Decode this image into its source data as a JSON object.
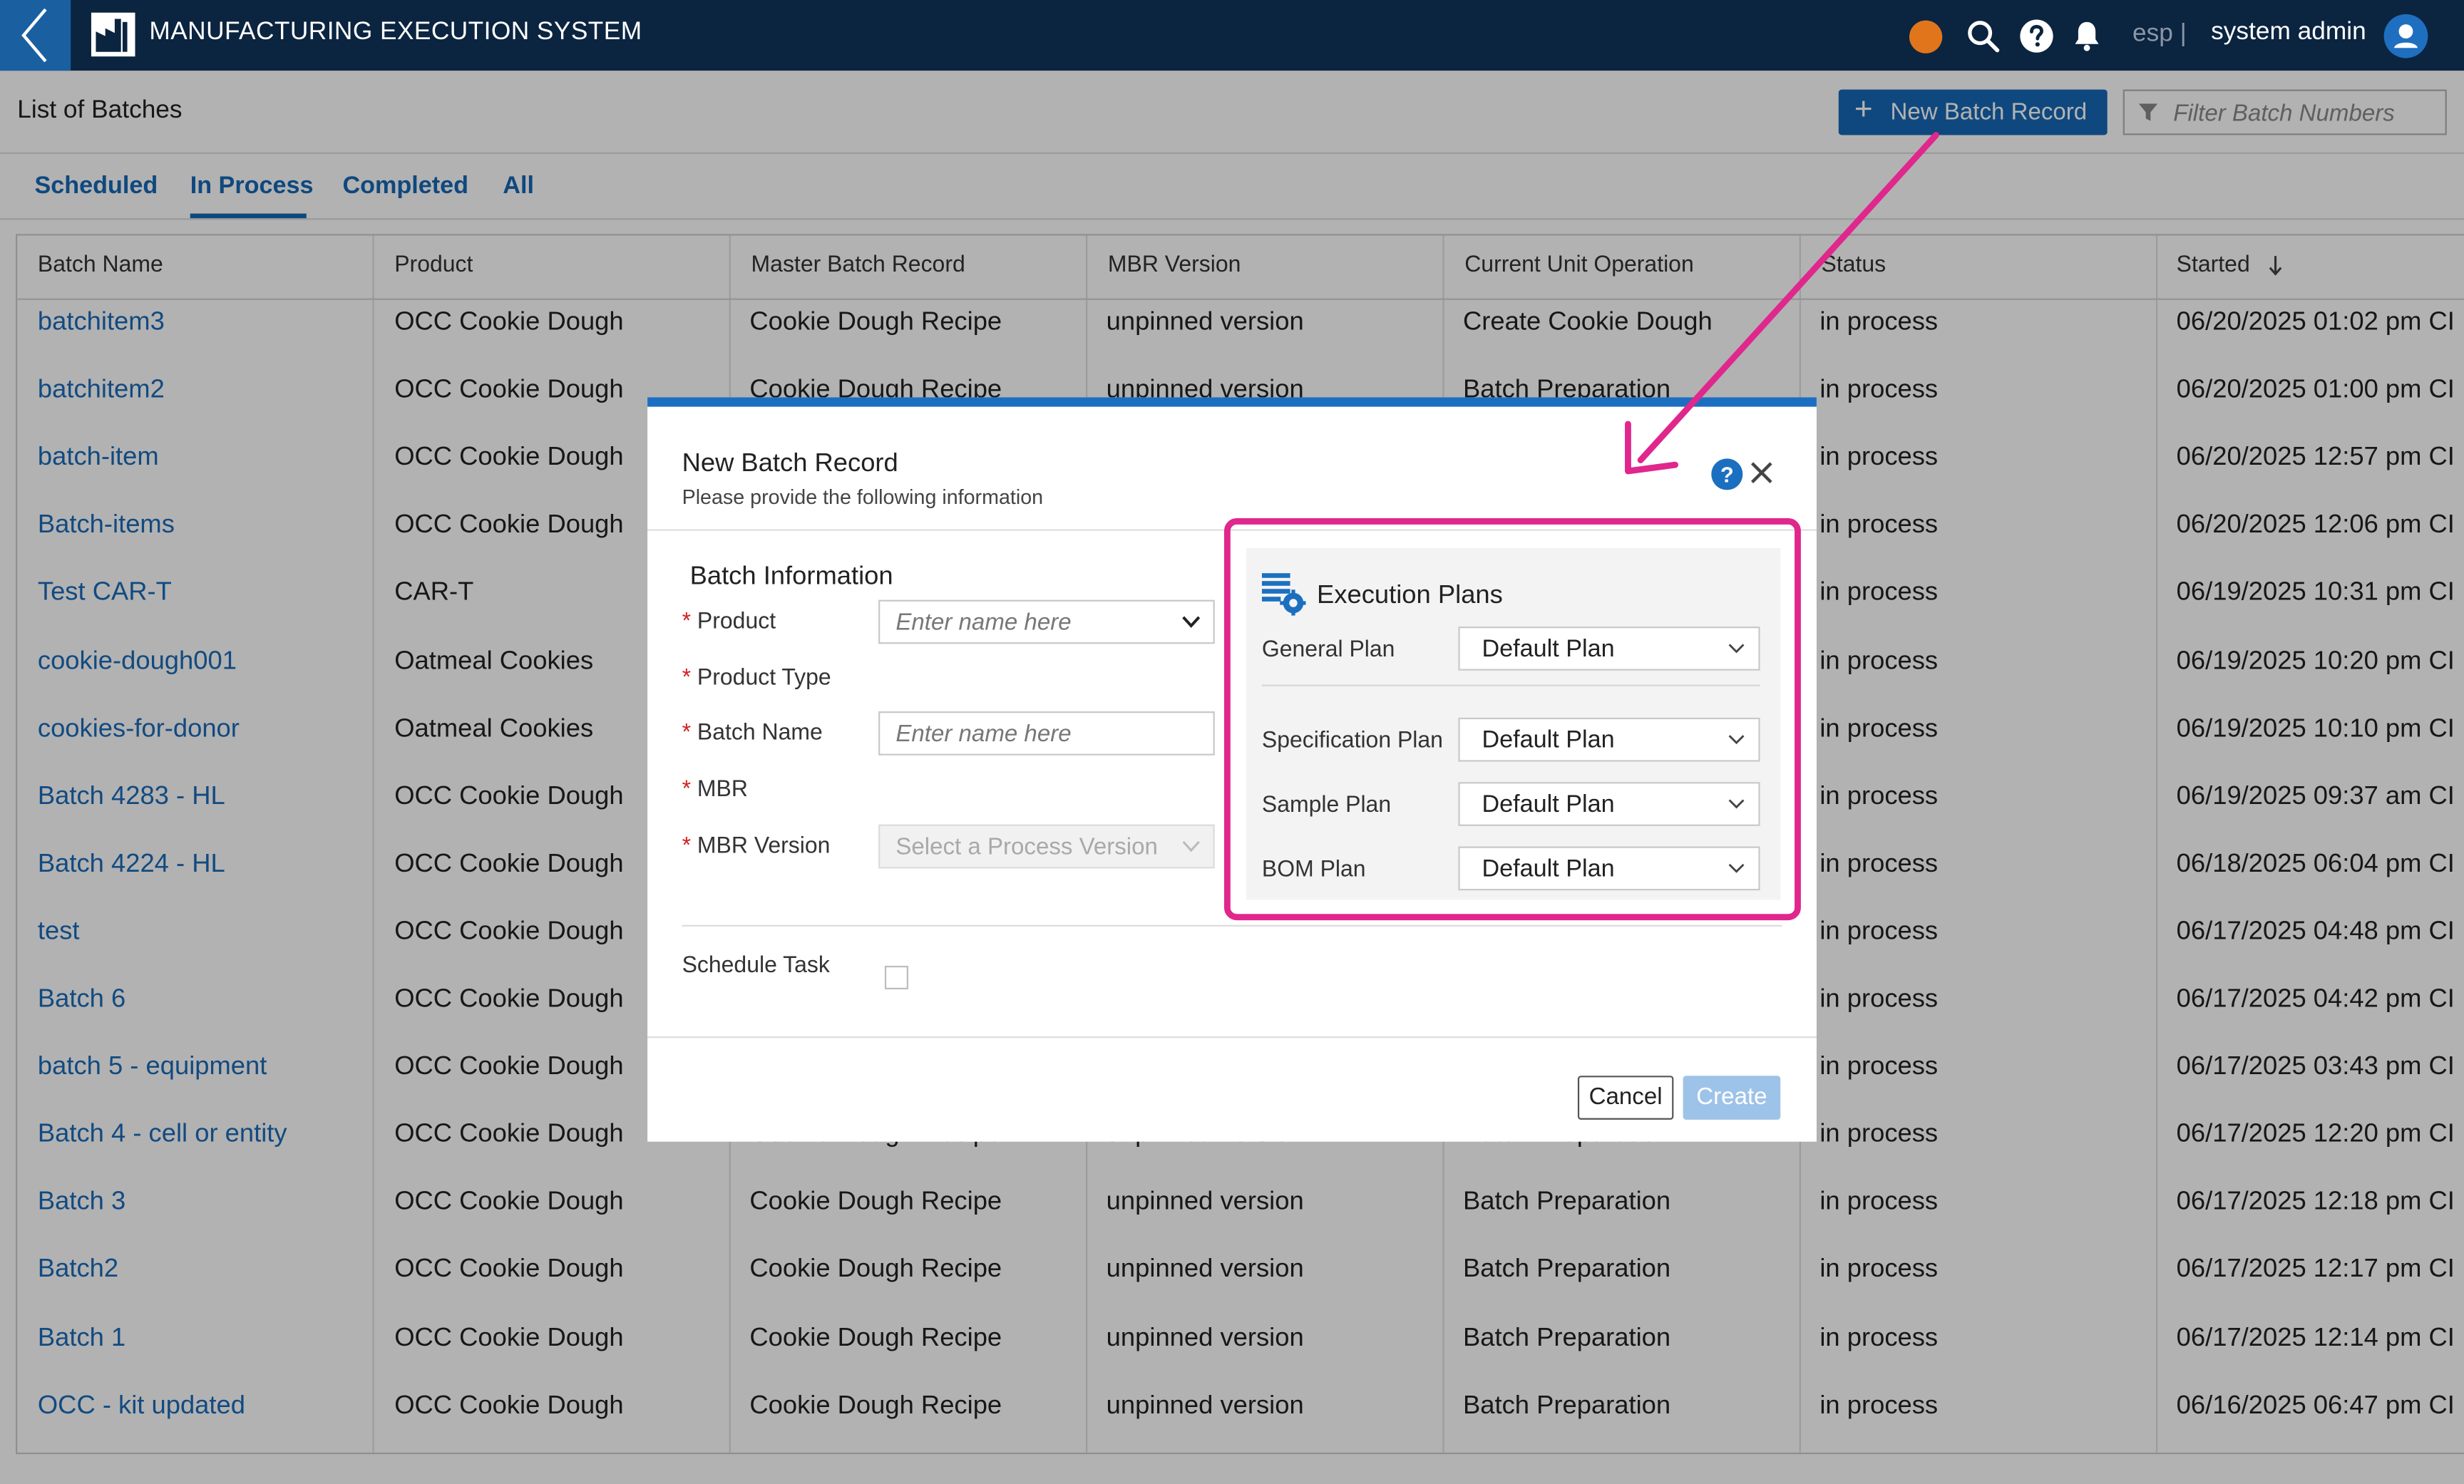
{
  "app": {
    "title": "MANUFACTURING EXECUTION SYSTEM",
    "language": "esp",
    "language_sep": "|",
    "user": "system admin"
  },
  "page": {
    "title": "List of Batches",
    "new_batch_label": "New Batch Record",
    "filter_placeholder": "Filter Batch Numbers"
  },
  "tabs": [
    {
      "label": "Scheduled",
      "active": false
    },
    {
      "label": "In Process",
      "active": true
    },
    {
      "label": "Completed",
      "active": false
    },
    {
      "label": "All",
      "active": false
    }
  ],
  "table": {
    "columns": [
      "Batch Name",
      "Product",
      "Master Batch Record",
      "MBR Version",
      "Current Unit Operation",
      "Status",
      "Started"
    ],
    "sort_column": "Started",
    "rows": [
      [
        "batchitem3",
        "OCC Cookie Dough",
        "Cookie Dough Recipe",
        "unpinned version",
        "Create Cookie Dough",
        "in process",
        "06/20/2025 01:02 pm CI"
      ],
      [
        "batchitem2",
        "OCC Cookie Dough",
        "Cookie Dough Recipe",
        "unpinned version",
        "Batch Preparation",
        "in process",
        "06/20/2025 01:00 pm CI"
      ],
      [
        "batch-item",
        "OCC Cookie Dough",
        "",
        "",
        "",
        "in process",
        "06/20/2025 12:57 pm CI"
      ],
      [
        "Batch-items",
        "OCC Cookie Dough",
        "",
        "",
        "",
        "in process",
        "06/20/2025 12:06 pm CI"
      ],
      [
        "Test CAR-T",
        "CAR-T",
        "",
        "",
        "",
        "in process",
        "06/19/2025 10:31 pm CI"
      ],
      [
        "cookie-dough001",
        "Oatmeal Cookies",
        "",
        "",
        "",
        "in process",
        "06/19/2025 10:20 pm CI"
      ],
      [
        "cookies-for-donor",
        "Oatmeal Cookies",
        "",
        "",
        "",
        "in process",
        "06/19/2025 10:10 pm CI"
      ],
      [
        "Batch 4283 - HL",
        "OCC Cookie Dough",
        "",
        "",
        "",
        "in process",
        "06/19/2025 09:37 am CI"
      ],
      [
        "Batch 4224 - HL",
        "OCC Cookie Dough",
        "",
        "",
        "",
        "in process",
        "06/18/2025 06:04 pm CI"
      ],
      [
        "test",
        "OCC Cookie Dough",
        "",
        "",
        "",
        "in process",
        "06/17/2025 04:48 pm CI"
      ],
      [
        "Batch 6",
        "OCC Cookie Dough",
        "",
        "",
        "",
        "in process",
        "06/17/2025 04:42 pm CI"
      ],
      [
        "batch 5 - equipment",
        "OCC Cookie Dough",
        "",
        "",
        "",
        "in process",
        "06/17/2025 03:43 pm CI"
      ],
      [
        "Batch 4 - cell or entity",
        "OCC Cookie Dough",
        "Cookie Dough Recipe",
        "unpinned version",
        "Batch Preparation",
        "in process",
        "06/17/2025 12:20 pm CI"
      ],
      [
        "Batch 3",
        "OCC Cookie Dough",
        "Cookie Dough Recipe",
        "unpinned version",
        "Batch Preparation",
        "in process",
        "06/17/2025 12:18 pm CI"
      ],
      [
        "Batch2",
        "OCC Cookie Dough",
        "Cookie Dough Recipe",
        "unpinned version",
        "Batch Preparation",
        "in process",
        "06/17/2025 12:17 pm CI"
      ],
      [
        "Batch 1",
        "OCC Cookie Dough",
        "Cookie Dough Recipe",
        "unpinned version",
        "Batch Preparation",
        "in process",
        "06/17/2025 12:14 pm CI"
      ],
      [
        "OCC - kit updated",
        "OCC Cookie Dough",
        "Cookie Dough Recipe",
        "unpinned version",
        "Batch Preparation",
        "in process",
        "06/16/2025 06:47 pm CI"
      ]
    ]
  },
  "modal": {
    "title": "New Batch Record",
    "subtitle": "Please provide the following information",
    "help": "?",
    "section_title": "Batch Information",
    "fields": {
      "product": {
        "label": "Product",
        "placeholder": "Enter name here"
      },
      "product_type": {
        "label": "Product Type"
      },
      "batch_name": {
        "label": "Batch Name",
        "placeholder": "Enter name here"
      },
      "mbr": {
        "label": "MBR"
      },
      "mbr_version": {
        "label": "MBR Version",
        "placeholder": "Select a Process Version"
      }
    },
    "schedule_task_label": "Schedule Task",
    "schedule_task_checked": false,
    "cancel_label": "Cancel",
    "create_label": "Create",
    "execution_plans": {
      "title": "Execution Plans",
      "general": {
        "label": "General Plan",
        "value": "Default Plan"
      },
      "specification": {
        "label": "Specification Plan",
        "value": "Default Plan"
      },
      "sample": {
        "label": "Sample Plan",
        "value": "Default Plan"
      },
      "bom": {
        "label": "BOM Plan",
        "value": "Default Plan"
      }
    }
  },
  "colors": {
    "nav_bg": "#0b2440",
    "accent": "#1667b5",
    "highlight": "#e0278d",
    "status_dot": "#e0751c"
  }
}
